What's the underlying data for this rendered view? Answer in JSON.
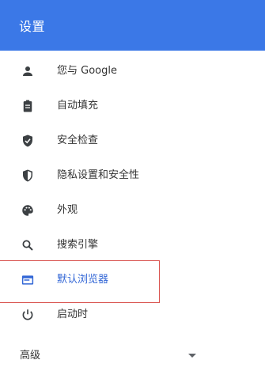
{
  "header": {
    "title": "设置"
  },
  "nav": {
    "items": [
      {
        "label": "您与 Google",
        "icon": "person-icon"
      },
      {
        "label": "自动填充",
        "icon": "clipboard-icon"
      },
      {
        "label": "安全检查",
        "icon": "shield-check-icon"
      },
      {
        "label": "隐私设置和安全性",
        "icon": "shield-half-icon"
      },
      {
        "label": "外观",
        "icon": "palette-icon"
      },
      {
        "label": "搜索引擎",
        "icon": "search-icon"
      },
      {
        "label": "默认浏览器",
        "icon": "browser-window-icon",
        "selected": true
      },
      {
        "label": "启动时",
        "icon": "power-icon"
      }
    ],
    "advanced_label": "高级"
  },
  "colors": {
    "header_bg": "#3b78e7",
    "selected": "#3367d6",
    "icon": "#5f6368",
    "highlight_border": "#d9534f"
  }
}
